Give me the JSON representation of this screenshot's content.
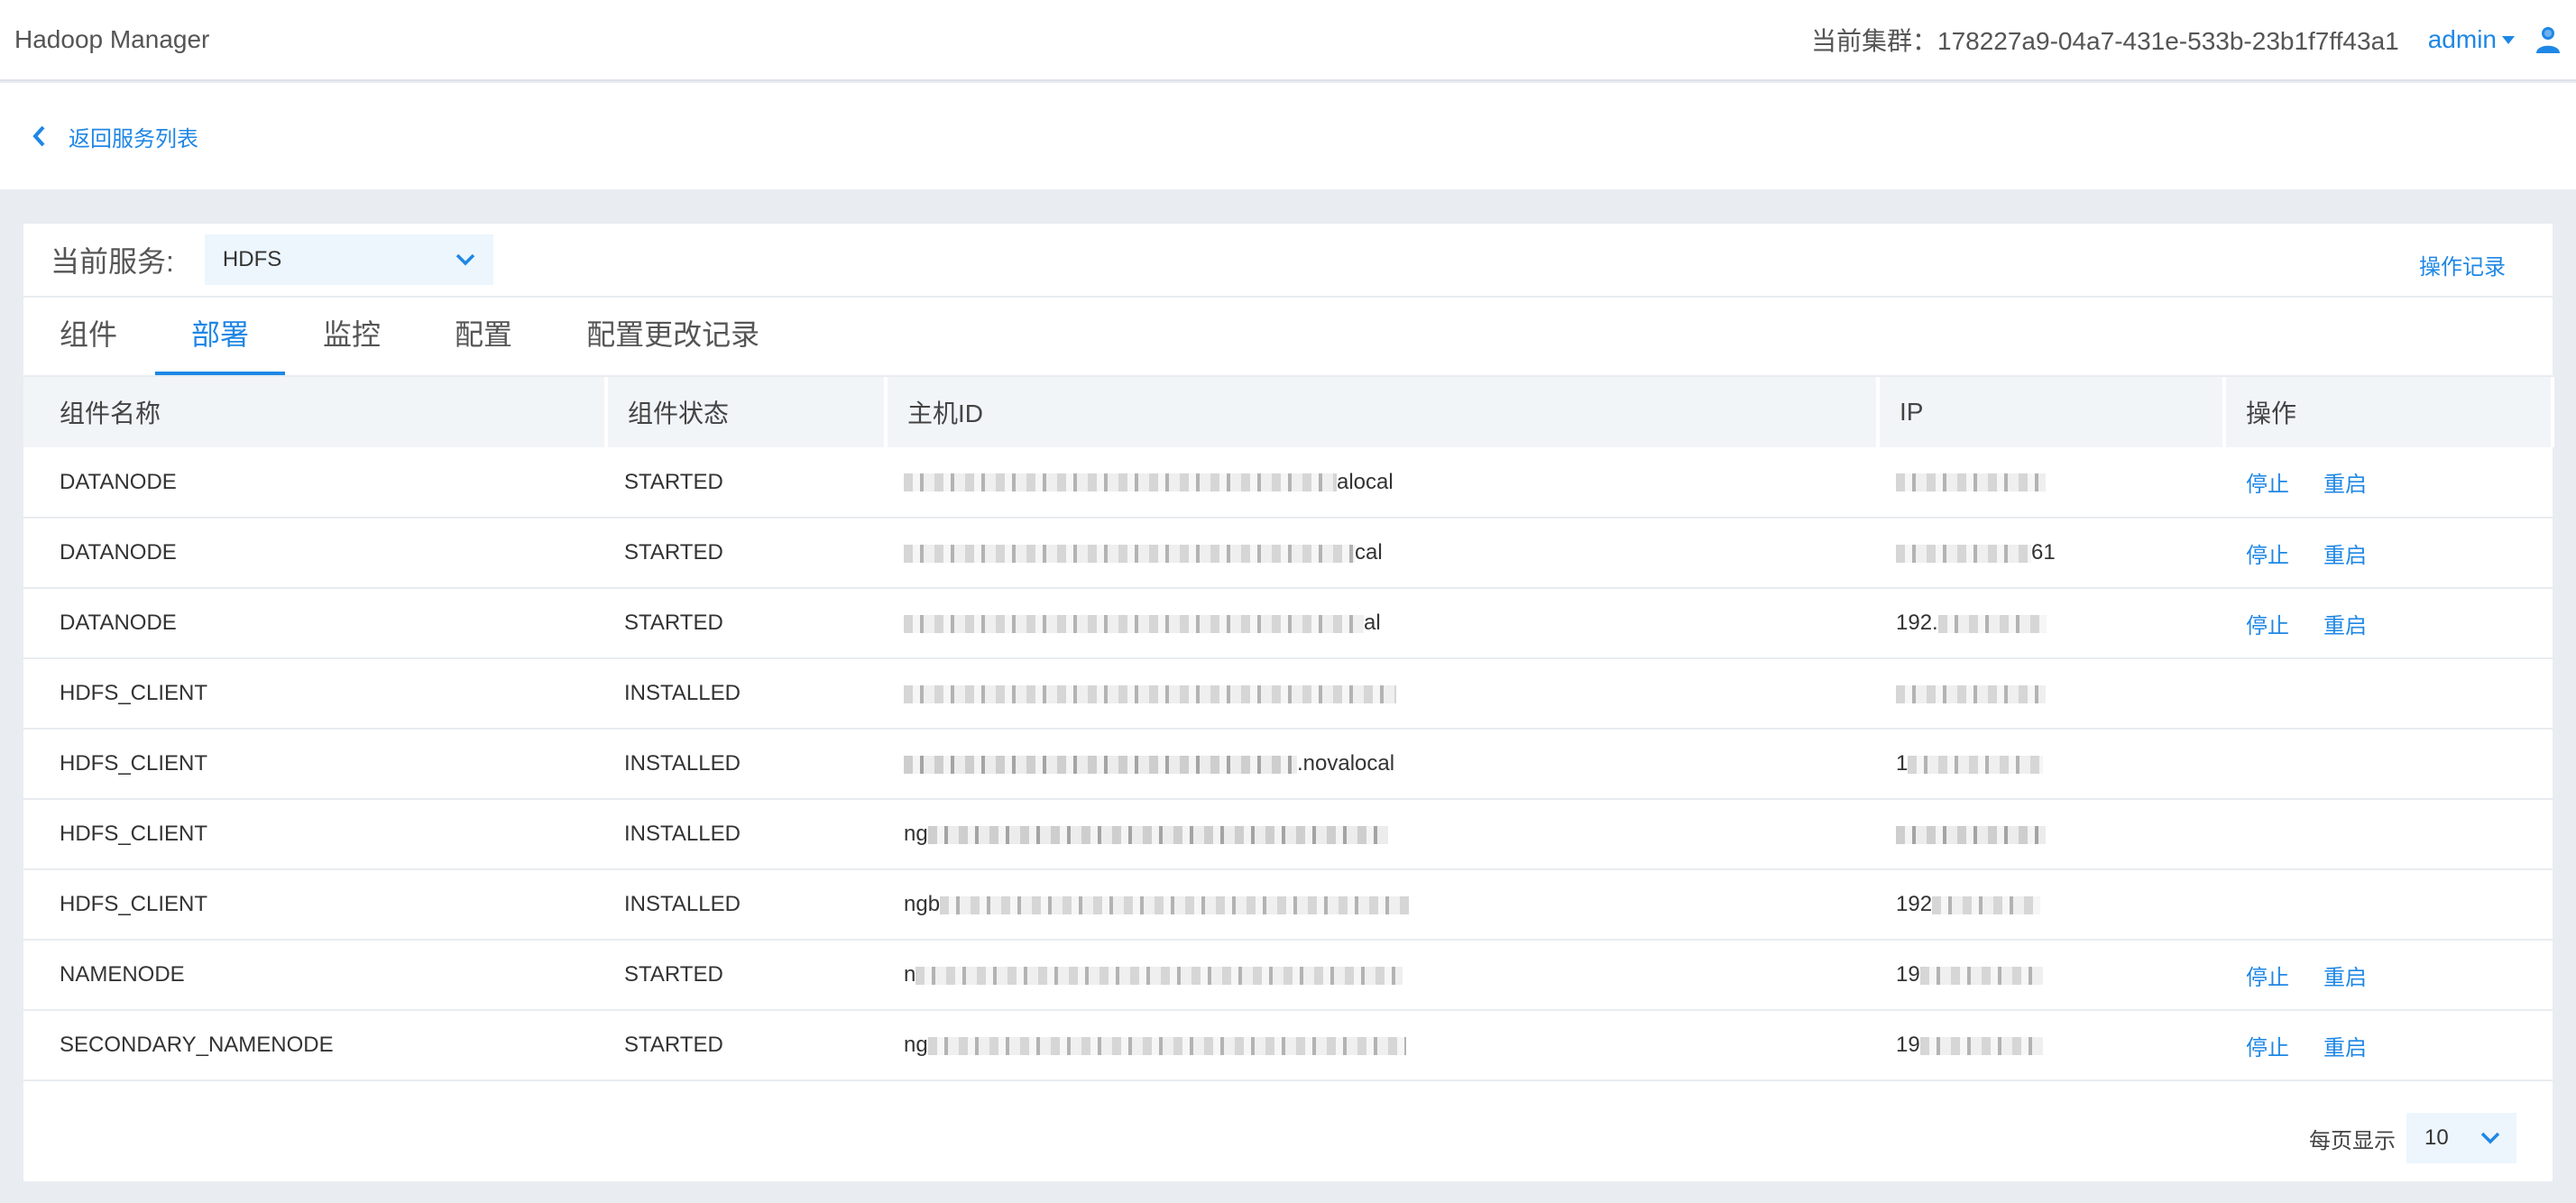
{
  "header": {
    "app_title": "Hadoop Manager",
    "cluster_text": "当前集群：178227a9-04a7-431e-533b-23b1f7ff43a1",
    "user": "admin"
  },
  "back": {
    "label": "返回服务列表"
  },
  "service": {
    "label": "当前服务:",
    "selected": "HDFS",
    "op_log": "操作记录"
  },
  "tabs": [
    {
      "label": "组件"
    },
    {
      "label": "部署"
    },
    {
      "label": "监控"
    },
    {
      "label": "配置"
    },
    {
      "label": "配置更改记录"
    }
  ],
  "table": {
    "headers": [
      "组件名称",
      "组件状态",
      "主机ID",
      "IP",
      "操作"
    ],
    "stop_label": "停止",
    "restart_label": "重启",
    "rows": [
      {
        "name": "DATANODE",
        "status": "STARTED",
        "host": "alocal",
        "ip": ""
      },
      {
        "name": "DATANODE",
        "status": "STARTED",
        "host": "cal",
        "ip": "61"
      },
      {
        "name": "DATANODE",
        "status": "STARTED",
        "host": "al",
        "ip": "192."
      },
      {
        "name": "HDFS_CLIENT",
        "status": "INSTALLED",
        "host": "",
        "ip": ""
      },
      {
        "name": "HDFS_CLIENT",
        "status": "INSTALLED",
        "host": ".novalocal",
        "ip": "1"
      },
      {
        "name": "HDFS_CLIENT",
        "status": "INSTALLED",
        "host": "ng",
        "ip": ""
      },
      {
        "name": "HDFS_CLIENT",
        "status": "INSTALLED",
        "host": "ngb",
        "ip": "192"
      },
      {
        "name": "NAMENODE",
        "status": "STARTED",
        "host": "n",
        "ip": "19"
      },
      {
        "name": "SECONDARY_NAMENODE",
        "status": "STARTED",
        "host": "ng",
        "ip": "19"
      }
    ]
  },
  "pagination": {
    "label": "每页显示",
    "page_size": "10"
  },
  "colors": {
    "accent": "#1f87e5",
    "page_bg": "#e9edf2",
    "select_bg": "#edf6fd"
  }
}
